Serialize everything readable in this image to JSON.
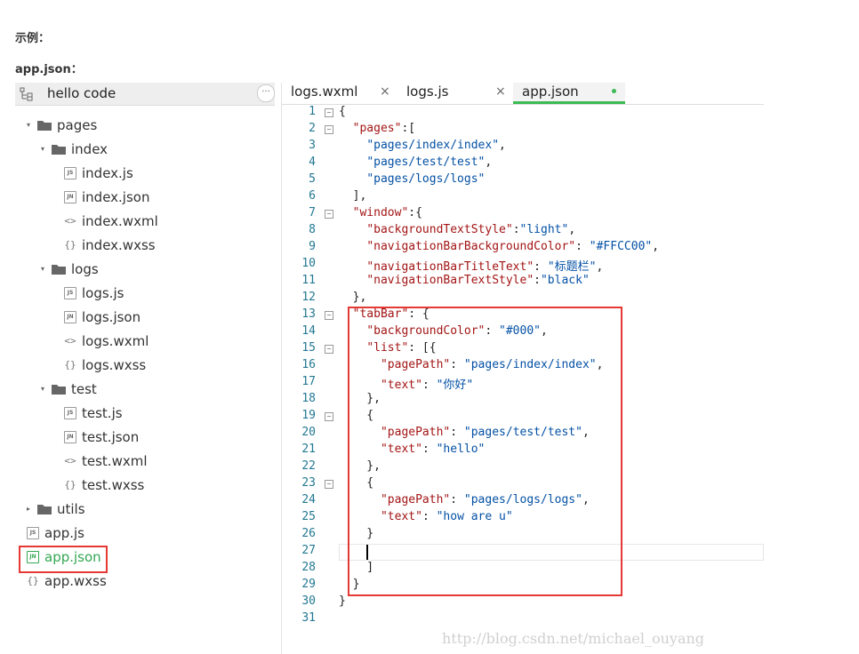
{
  "doc": {
    "label_example": "示例：",
    "label_file": "app.json："
  },
  "sidebar": {
    "project_name": "hello code",
    "more_label": "···",
    "tree": [
      {
        "label": "pages",
        "kind": "folder",
        "arrow": "▾"
      },
      {
        "label": "index",
        "kind": "folder",
        "arrow": "▾"
      },
      {
        "label": "index.js",
        "kind": "js",
        "icon_text": "JS"
      },
      {
        "label": "index.json",
        "kind": "json",
        "icon_text": "JN"
      },
      {
        "label": "index.wxml",
        "kind": "wxml",
        "icon_text": "<>"
      },
      {
        "label": "index.wxss",
        "kind": "wxss",
        "icon_text": "{}"
      },
      {
        "label": "logs",
        "kind": "folder",
        "arrow": "▾"
      },
      {
        "label": "logs.js",
        "kind": "js",
        "icon_text": "JS"
      },
      {
        "label": "logs.json",
        "kind": "json",
        "icon_text": "JN"
      },
      {
        "label": "logs.wxml",
        "kind": "wxml",
        "icon_text": "<>"
      },
      {
        "label": "logs.wxss",
        "kind": "wxss",
        "icon_text": "{}"
      },
      {
        "label": "test",
        "kind": "folder",
        "arrow": "▾"
      },
      {
        "label": "test.js",
        "kind": "js",
        "icon_text": "JS"
      },
      {
        "label": "test.json",
        "kind": "json",
        "icon_text": "JN"
      },
      {
        "label": "test.wxml",
        "kind": "wxml",
        "icon_text": "<>"
      },
      {
        "label": "test.wxss",
        "kind": "wxss",
        "icon_text": "{}"
      },
      {
        "label": "utils",
        "kind": "folder",
        "arrow": "▸"
      },
      {
        "label": "app.js",
        "kind": "js",
        "icon_text": "JS"
      },
      {
        "label": "app.json",
        "kind": "json",
        "icon_text": "JN",
        "active": true
      },
      {
        "label": "app.wxss",
        "kind": "wxss",
        "icon_text": "{}"
      }
    ]
  },
  "tabs": [
    {
      "label": "logs.wxml",
      "close": "×"
    },
    {
      "label": "logs.js",
      "close": "×"
    },
    {
      "label": "app.json",
      "active": true
    }
  ],
  "editor": {
    "lines": [
      "{",
      "  \"pages\":[",
      "    \"pages/index/index\",",
      "    \"pages/test/test\",",
      "    \"pages/logs/logs\"",
      "  ],",
      "  \"window\":{",
      "    \"backgroundTextStyle\":\"light\",",
      "    \"navigationBarBackgroundColor\": \"#FFCC00\",",
      "    \"navigationBarTitleText\": \"标题栏\",",
      "    \"navigationBarTextStyle\":\"black\"",
      "  },",
      "  \"tabBar\": {",
      "    \"backgroundColor\": \"#000\",",
      "    \"list\": [{",
      "      \"pagePath\": \"pages/index/index\",",
      "      \"text\": \"你好\"",
      "    },",
      "    {",
      "      \"pagePath\": \"pages/test/test\",",
      "      \"text\": \"hello\"",
      "    },",
      "    {",
      "      \"pagePath\": \"pages/logs/logs\",",
      "      \"text\": \"how are u\"",
      "    }",
      "",
      "    ]",
      "  }",
      "}",
      ""
    ],
    "fold_lines": [
      1,
      2,
      7,
      13,
      15,
      19,
      23
    ]
  },
  "watermark": "http://blog.csdn.net/michael_ouyang",
  "colors": {
    "accent": "#3cba54",
    "highlight": "#e53935"
  }
}
